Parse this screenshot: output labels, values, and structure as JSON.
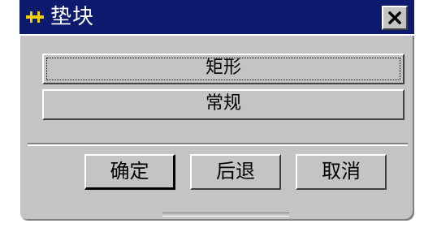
{
  "window": {
    "title": "垫块",
    "icon": "pad-block-icon",
    "close_icon": "close-icon"
  },
  "buttons": {
    "rectangle": "矩形",
    "general": "常规"
  },
  "actions": {
    "ok": "确定",
    "back": "后退",
    "cancel": "取消"
  },
  "colors": {
    "titlebar": "#0d1a6e",
    "dialog_bg": "#c4c4c4",
    "icon_accent": "#f0d000"
  }
}
